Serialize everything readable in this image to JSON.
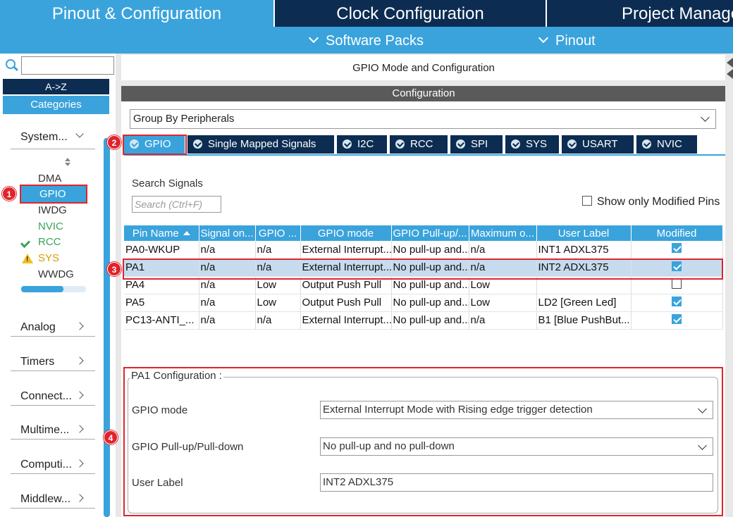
{
  "top_tabs": [
    {
      "label": "Pinout & Configuration",
      "color": "#3aa3dc"
    },
    {
      "label": "Clock Configuration",
      "color": "#0c2c52"
    },
    {
      "label": "Project Manage",
      "color": "#0c2c52"
    }
  ],
  "sub_menu": {
    "software_packs": "Software Packs",
    "pinout": "Pinout"
  },
  "left": {
    "search_value": "",
    "az": "A->Z",
    "categories": "Categories",
    "system": "System...",
    "peripherals": [
      "DMA",
      "GPIO",
      "IWDG",
      "NVIC",
      "RCC",
      "SYS",
      "WWDG"
    ],
    "category_list": [
      "Analog",
      "Timers",
      "Connect...",
      "Multime...",
      "Computi...",
      "Middlew..."
    ]
  },
  "right": {
    "title": "GPIO Mode and Configuration",
    "config_bar": "Configuration",
    "group_by": "Group By Peripherals",
    "tabs": [
      "GPIO",
      "Single Mapped Signals",
      "I2C",
      "RCC",
      "SPI",
      "SYS",
      "USART",
      "NVIC"
    ],
    "search_label": "Search Signals",
    "search_placeholder": "Search (Ctrl+F)",
    "show_modified": "Show only Modified Pins",
    "columns": [
      "Pin Name",
      "Signal on...",
      "GPIO ...",
      "GPIO mode",
      "GPIO Pull-up/...",
      "Maximum o...",
      "User Label",
      "Modified"
    ],
    "rows": [
      {
        "pin": "PA0-WKUP",
        "signal": "n/a",
        "gpio": "n/a",
        "mode": "External Interrupt...",
        "pull": "No pull-up and...",
        "max": "n/a",
        "label": "INT1 ADXL375",
        "modified": true
      },
      {
        "pin": "PA1",
        "signal": "n/a",
        "gpio": "n/a",
        "mode": "External Interrupt...",
        "pull": "No pull-up and...",
        "max": "n/a",
        "label": "INT2 ADXL375",
        "modified": true
      },
      {
        "pin": "PA4",
        "signal": "n/a",
        "gpio": "Low",
        "mode": "Output Push Pull",
        "pull": "No pull-up and...",
        "max": "Low",
        "label": "",
        "modified": false
      },
      {
        "pin": "PA5",
        "signal": "n/a",
        "gpio": "Low",
        "mode": "Output Push Pull",
        "pull": "No pull-up and...",
        "max": "Low",
        "label": "LD2 [Green Led]",
        "modified": true
      },
      {
        "pin": "PC13-ANTI_...",
        "signal": "n/a",
        "gpio": "n/a",
        "mode": "External Interrupt...",
        "pull": "No pull-up and...",
        "max": "n/a",
        "label": "B1 [Blue PushBut...",
        "modified": true
      }
    ],
    "pa1_config": {
      "legend": "PA1 Configuration :",
      "mode_label": "GPIO mode",
      "mode_value": "External Interrupt Mode with Rising edge trigger detection",
      "pull_label": "GPIO Pull-up/Pull-down",
      "pull_value": "No pull-up and no pull-down",
      "user_label": "User Label",
      "user_value": "INT2 ADXL375"
    }
  },
  "badges": [
    "1",
    "2",
    "3",
    "4"
  ]
}
